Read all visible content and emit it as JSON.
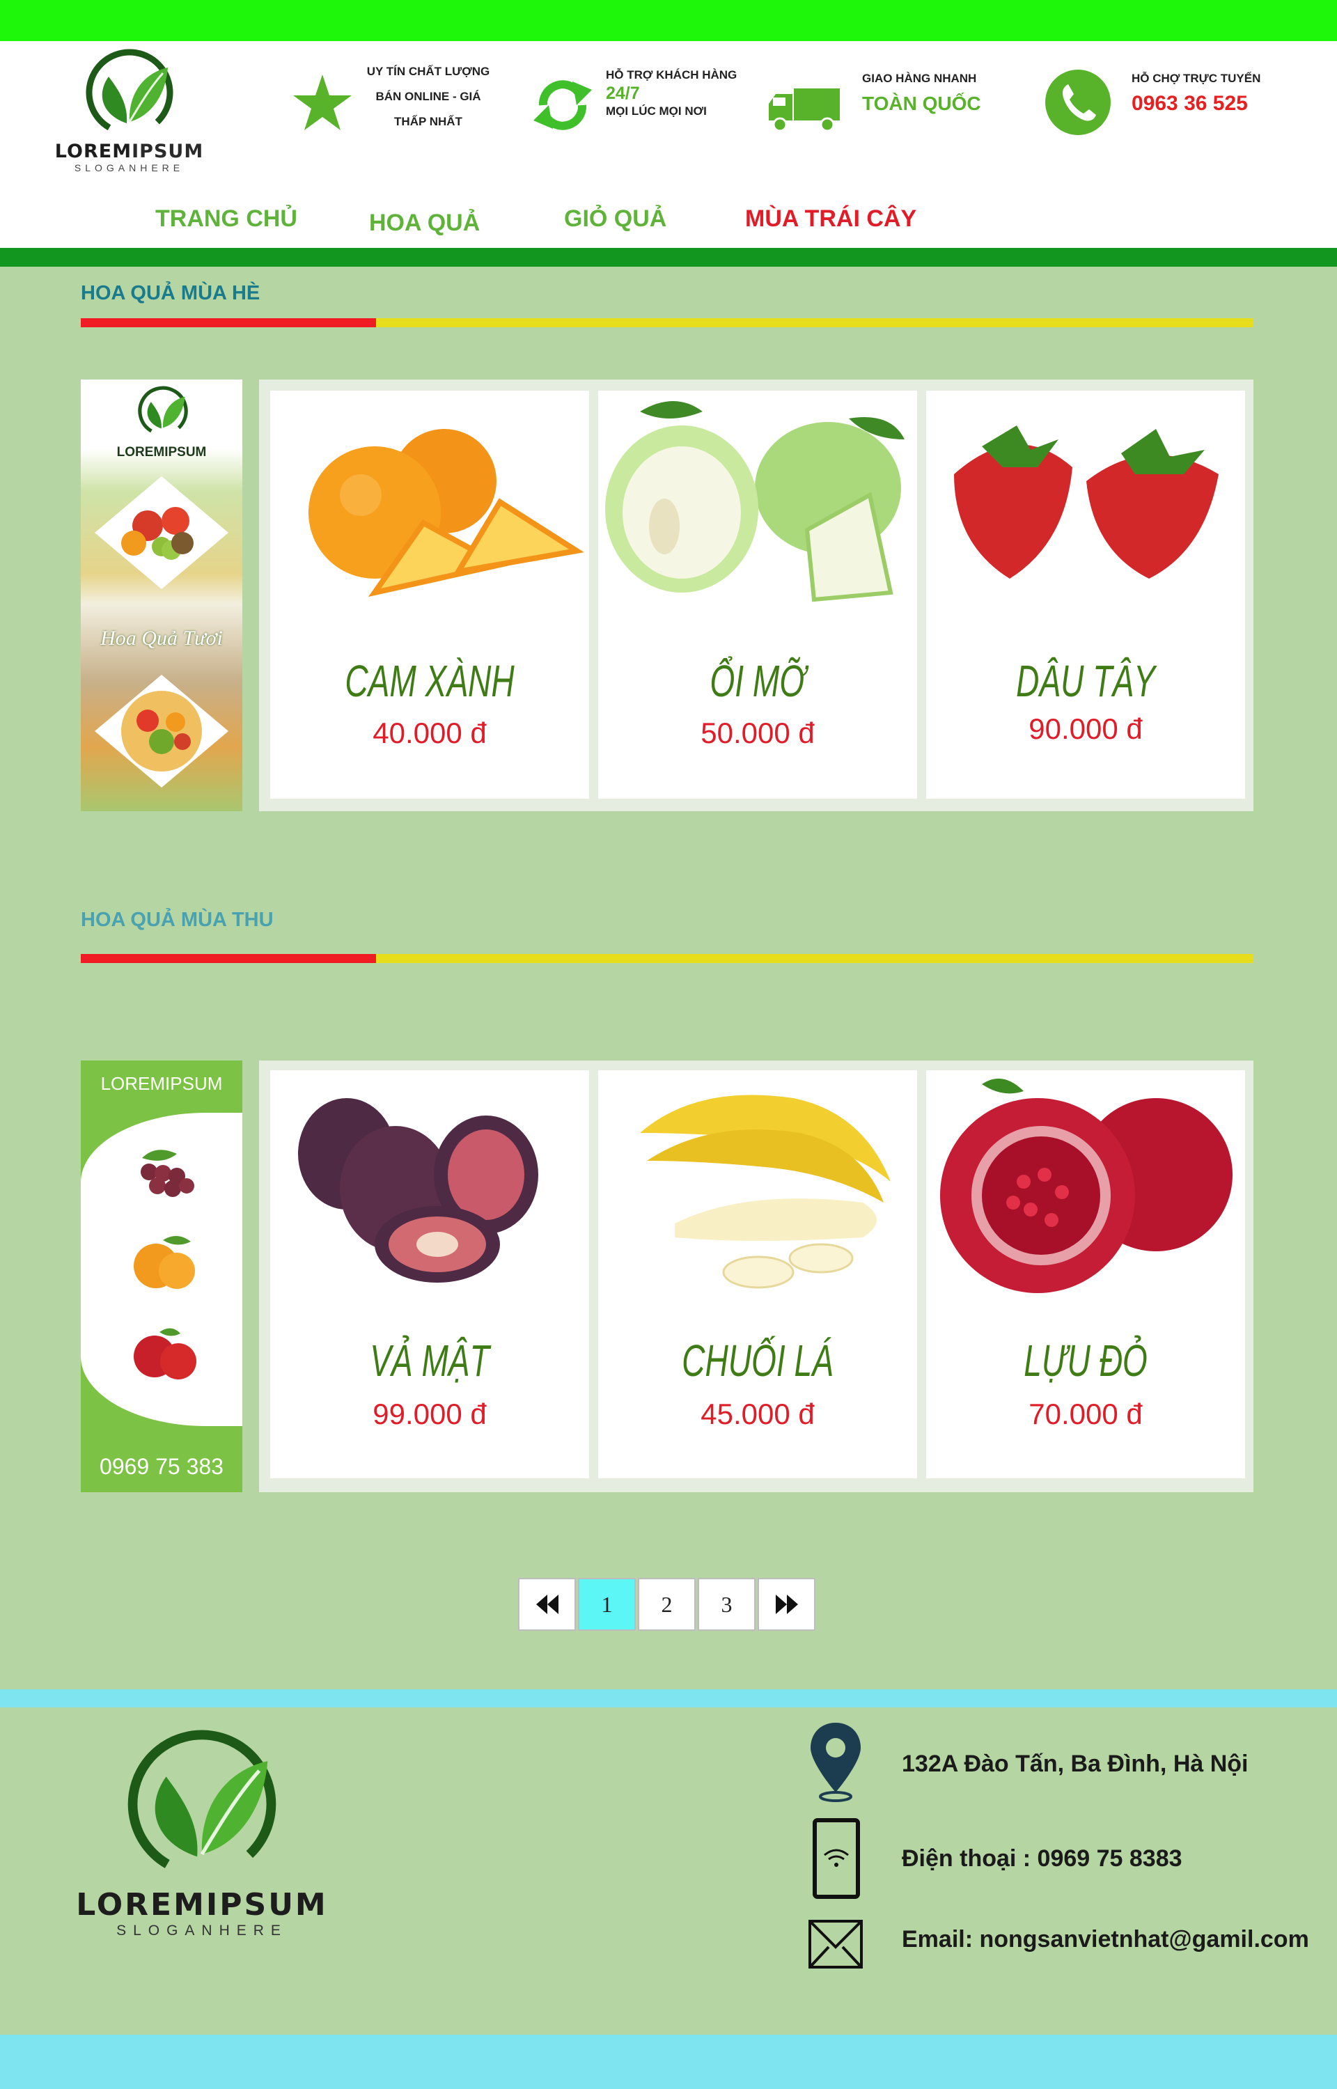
{
  "brand": {
    "name_part1": "LOREM",
    "name_part2": "IPSUM",
    "slogan": "SLOGANHERE"
  },
  "features": [
    {
      "icon": "star-icon",
      "lines": [
        "UY TÍN CHẤT LƯỢNG",
        "BÁN ONLINE - GIÁ",
        "THẤP NHẤT"
      ]
    },
    {
      "icon": "refresh-icon",
      "line1": "HỖ TRỢ KHÁCH HÀNG",
      "highlight": "24/7",
      "line2": "MỌI LÚC MỌI NƠI"
    },
    {
      "icon": "truck-icon",
      "line1": "GIAO HÀNG NHANH",
      "highlight": "TOÀN QUỐC"
    },
    {
      "icon": "phone-icon",
      "line1": "HỖ CHỢ TRỰC TUYẾN",
      "highlight": "0963 36 525"
    }
  ],
  "nav": [
    {
      "label": "TRANG CHỦ",
      "active": false
    },
    {
      "label": "HOA QUẢ",
      "active": false
    },
    {
      "label": "GIỎ QUẢ",
      "active": false
    },
    {
      "label": "MÙA TRÁI CÂY",
      "active": true
    }
  ],
  "sections": [
    {
      "title": "HOA QUẢ MÙA HÈ",
      "title_color": "#1a7b8c",
      "banner": {
        "brand": "LOREMIPSUM",
        "caption": "Hoa Quả Tươi"
      },
      "products": [
        {
          "name": "CAM XÀNH",
          "price": "40.000 đ",
          "image": "orange"
        },
        {
          "name": "ỔI MỠ",
          "price": "50.000 đ",
          "image": "guava"
        },
        {
          "name": "DÂU TÂY",
          "price": "90.000 đ",
          "image": "strawberry"
        }
      ]
    },
    {
      "title": "HOA QUẢ MÙA THU",
      "title_color": "#4aa1b0",
      "banner": {
        "brand": "LOREMIPSUM",
        "phone": "0969 75 383"
      },
      "products": [
        {
          "name": "VẢ MẬT",
          "price": "99.000 đ",
          "image": "fig"
        },
        {
          "name": "CHUỐI LÁ",
          "price": "45.000 đ",
          "image": "banana"
        },
        {
          "name": "LỰU ĐỎ",
          "price": "70.000 đ",
          "image": "pomegranate"
        }
      ]
    }
  ],
  "pagination": {
    "pages": [
      "1",
      "2",
      "3"
    ],
    "current": "1"
  },
  "footer": {
    "address": "132A Đào Tấn, Ba Đình, Hà Nội",
    "phone": "Điện thoại : 0969 75 8383",
    "email": "Email: nongsanvietnhat@gamil.com"
  },
  "colors": {
    "accent_green": "#5fb33a",
    "active_red": "#e01c28",
    "header_line": "#13961f",
    "background": "#b5d6a3"
  }
}
